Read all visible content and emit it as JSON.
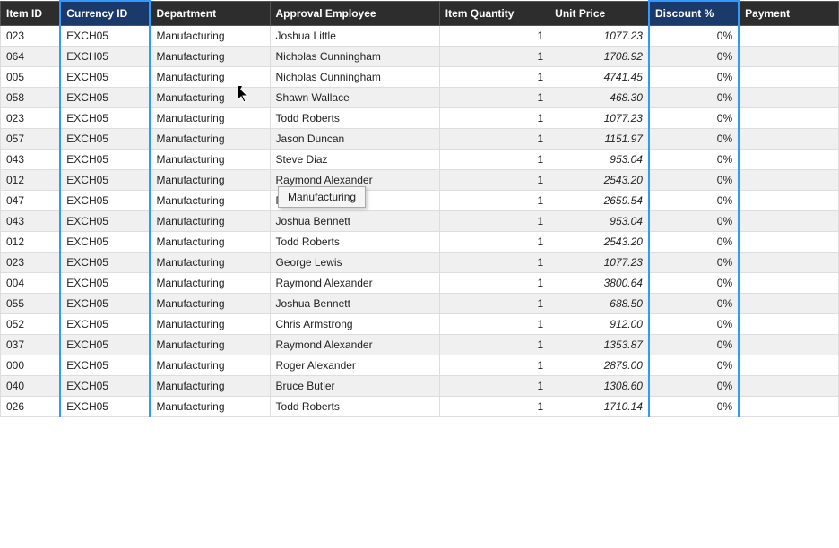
{
  "columns": [
    {
      "id": "item-id",
      "label": "Item ID",
      "class": "col-item-id",
      "highlighted": false
    },
    {
      "id": "currency-id",
      "label": "Currency ID",
      "class": "col-currency",
      "highlighted": true
    },
    {
      "id": "department",
      "label": "Department",
      "class": "col-dept",
      "highlighted": false
    },
    {
      "id": "approval-employee",
      "label": "Approval Employee",
      "class": "col-approval",
      "highlighted": false
    },
    {
      "id": "item-quantity",
      "label": "Item Quantity",
      "class": "col-qty",
      "highlighted": false
    },
    {
      "id": "unit-price",
      "label": "Unit Price",
      "class": "col-price",
      "highlighted": false
    },
    {
      "id": "discount",
      "label": "Discount %",
      "class": "col-discount",
      "highlighted": true
    },
    {
      "id": "payment",
      "label": "Payment",
      "class": "col-payment",
      "highlighted": false
    }
  ],
  "rows": [
    {
      "item_id": "023",
      "currency": "EXCH05",
      "dept": "Manufacturing",
      "employee": "Joshua Little",
      "qty": "1",
      "price": "1077.23",
      "discount": "0%",
      "payment": ""
    },
    {
      "item_id": "064",
      "currency": "EXCH05",
      "dept": "Manufacturing",
      "employee": "Nicholas Cunningham",
      "qty": "1",
      "price": "1708.92",
      "discount": "0%",
      "payment": ""
    },
    {
      "item_id": "005",
      "currency": "EXCH05",
      "dept": "Manufacturing",
      "employee": "Nicholas Cunningham",
      "qty": "1",
      "price": "4741.45",
      "discount": "0%",
      "payment": ""
    },
    {
      "item_id": "058",
      "currency": "EXCH05",
      "dept": "Manufacturing",
      "employee": "Shawn Wallace",
      "qty": "1",
      "price": "468.30",
      "discount": "0%",
      "payment": ""
    },
    {
      "item_id": "023",
      "currency": "EXCH05",
      "dept": "Manufacturing",
      "employee": "Todd Roberts",
      "qty": "1",
      "price": "1077.23",
      "discount": "0%",
      "payment": ""
    },
    {
      "item_id": "057",
      "currency": "EXCH05",
      "dept": "Manufacturing",
      "employee": "Jason Duncan",
      "qty": "1",
      "price": "1151.97",
      "discount": "0%",
      "payment": ""
    },
    {
      "item_id": "043",
      "currency": "EXCH05",
      "dept": "Manufacturing",
      "employee": "Steve Diaz",
      "qty": "1",
      "price": "953.04",
      "discount": "0%",
      "payment": ""
    },
    {
      "item_id": "012",
      "currency": "EXCH05",
      "dept": "Manufacturing",
      "employee": "Raymond Alexander",
      "qty": "1",
      "price": "2543.20",
      "discount": "0%",
      "payment": ""
    },
    {
      "item_id": "047",
      "currency": "EXCH05",
      "dept": "Manufacturing",
      "employee": "Paul Holmes",
      "qty": "1",
      "price": "2659.54",
      "discount": "0%",
      "payment": ""
    },
    {
      "item_id": "043",
      "currency": "EXCH05",
      "dept": "Manufacturing",
      "employee": "Joshua Bennett",
      "qty": "1",
      "price": "953.04",
      "discount": "0%",
      "payment": ""
    },
    {
      "item_id": "012",
      "currency": "EXCH05",
      "dept": "Manufacturing",
      "employee": "Todd Roberts",
      "qty": "1",
      "price": "2543.20",
      "discount": "0%",
      "payment": ""
    },
    {
      "item_id": "023",
      "currency": "EXCH05",
      "dept": "Manufacturing",
      "employee": "George Lewis",
      "qty": "1",
      "price": "1077.23",
      "discount": "0%",
      "payment": ""
    },
    {
      "item_id": "004",
      "currency": "EXCH05",
      "dept": "Manufacturing",
      "employee": "Raymond Alexander",
      "qty": "1",
      "price": "3800.64",
      "discount": "0%",
      "payment": ""
    },
    {
      "item_id": "055",
      "currency": "EXCH05",
      "dept": "Manufacturing",
      "employee": "Joshua Bennett",
      "qty": "1",
      "price": "688.50",
      "discount": "0%",
      "payment": ""
    },
    {
      "item_id": "052",
      "currency": "EXCH05",
      "dept": "Manufacturing",
      "employee": "Chris Armstrong",
      "qty": "1",
      "price": "912.00",
      "discount": "0%",
      "payment": ""
    },
    {
      "item_id": "037",
      "currency": "EXCH05",
      "dept": "Manufacturing",
      "employee": "Raymond Alexander",
      "qty": "1",
      "price": "1353.87",
      "discount": "0%",
      "payment": ""
    },
    {
      "item_id": "000",
      "currency": "EXCH05",
      "dept": "Manufacturing",
      "employee": "Roger Alexander",
      "qty": "1",
      "price": "2879.00",
      "discount": "0%",
      "payment": ""
    },
    {
      "item_id": "040",
      "currency": "EXCH05",
      "dept": "Manufacturing",
      "employee": "Bruce Butler",
      "qty": "1",
      "price": "1308.60",
      "discount": "0%",
      "payment": ""
    },
    {
      "item_id": "026",
      "currency": "EXCH05",
      "dept": "Manufacturing",
      "employee": "Todd Roberts",
      "qty": "1",
      "price": "1710.14",
      "discount": "0%",
      "payment": ""
    }
  ],
  "tooltip": "Manufacturing"
}
